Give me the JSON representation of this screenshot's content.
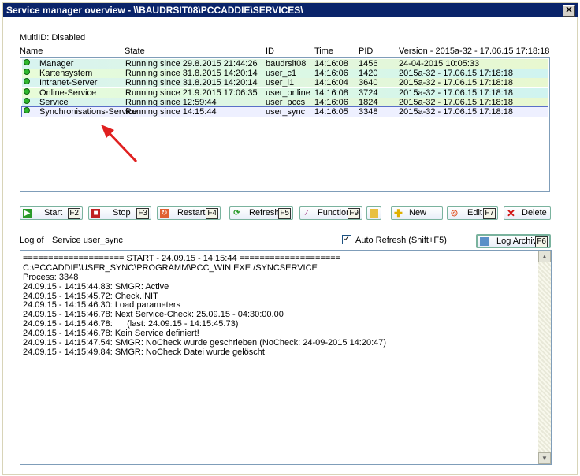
{
  "window": {
    "title": "Service manager overview - \\\\BAUDRSIT08\\PCCADDIE\\SERVICES\\",
    "close": "✕"
  },
  "multiid": "MultiID: Disabled",
  "columns": [
    "Name",
    "State",
    "ID",
    "Time",
    "PID",
    "Version - 2015a-32 - 17.06.15 17:18:18"
  ],
  "rows": [
    {
      "name": "Manager",
      "state": "Running since 29.8.2015 21:44:26",
      "id": "baudrsit08",
      "time": "14:16:08",
      "pid": "1456",
      "version": "24-04-2015 10:05:33"
    },
    {
      "name": "Kartensystem",
      "state": "Running since 31.8.2015 14:20:14",
      "id": "user_c1",
      "time": "14:16:06",
      "pid": "1420",
      "version": "2015a-32 - 17.06.15 17:18:18"
    },
    {
      "name": "Intranet-Server",
      "state": "Running since 31.8.2015 14:20:14",
      "id": "user_i1",
      "time": "14:16:04",
      "pid": "3640",
      "version": "2015a-32 - 17.06.15 17:18:18"
    },
    {
      "name": "Online-Service",
      "state": "Running since 21.9.2015 17:06:35",
      "id": "user_online",
      "time": "14:16:08",
      "pid": "3724",
      "version": "2015a-32 - 17.06.15 17:18:18"
    },
    {
      "name": "Service",
      "state": "Running since 12:59:44",
      "id": "user_pccs",
      "time": "14:16:06",
      "pid": "1824",
      "version": "2015a-32 - 17.06.15 17:18:18"
    },
    {
      "name": "Synchronisations-Service",
      "state": "Running since 14:15:44",
      "id": "user_sync",
      "time": "14:16:05",
      "pid": "3348",
      "version": "2015a-32 - 17.06.15 17:18:18"
    }
  ],
  "buttons": {
    "start": "Start",
    "start_key": "F2",
    "stop": "Stop",
    "stop_key": "F3",
    "restart": "Restart",
    "restart_key": "F4",
    "refresh": "Refresh",
    "refresh_key": "F5",
    "function": "Function",
    "function_key": "F9",
    "new": "New",
    "edit": "Edit",
    "edit_key": "F7",
    "delete": "Delete",
    "logarchiv": "Log Archiv",
    "logarchiv_key": "F6"
  },
  "log": {
    "label": "Log of",
    "service": "Service user_sync",
    "auto_refresh": "Auto Refresh (Shift+F5)",
    "auto_refresh_checked": true,
    "lines": [
      "==================== START - 24.09.15 - 14:15:44 ====================",
      "C:\\PCCADDIE\\USER_SYNC\\PROGRAMM\\PCC_WIN.EXE /SYNCSERVICE",
      "Process: 3348",
      "24.09.15 - 14:15:44.83: SMGR: Active",
      "24.09.15 - 14:15:45.72: Check.INIT",
      "24.09.15 - 14:15:46.30: Load parameters",
      "24.09.15 - 14:15:46.78: Next Service-Check: 25.09.15 - 04:30:00.00",
      "24.09.15 - 14:15:46.78:      (last: 24.09.15 - 14:15:45.73)",
      "24.09.15 - 14:15:46.78: Kein Service definiert!",
      "24.09.15 - 14:15:47.54: SMGR: NoCheck wurde geschrieben (NoCheck: 24-09-2015 14:20:47)",
      "24.09.15 - 14:15:49.84: SMGR: NoCheck Datei wurde gelöscht"
    ]
  }
}
